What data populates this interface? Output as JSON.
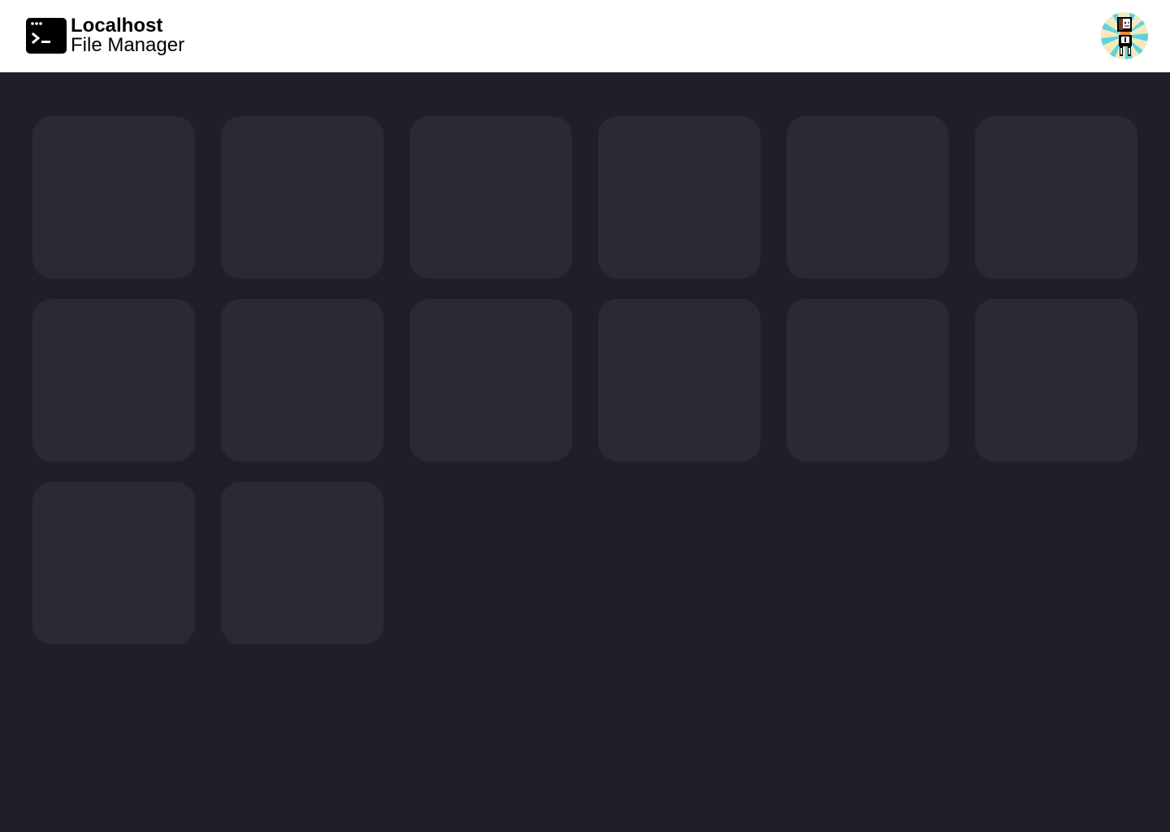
{
  "header": {
    "brand_title": "Localhost",
    "brand_subtitle": "File Manager",
    "logo_icon": "terminal-icon",
    "avatar_icon": "pixel-avatar-icon"
  },
  "colors": {
    "page_background": "#1f1f2a",
    "header_background": "#ffffff",
    "tile_background": "#292a34"
  },
  "grid": {
    "tile_count": 14,
    "state": "loading-placeholders"
  }
}
